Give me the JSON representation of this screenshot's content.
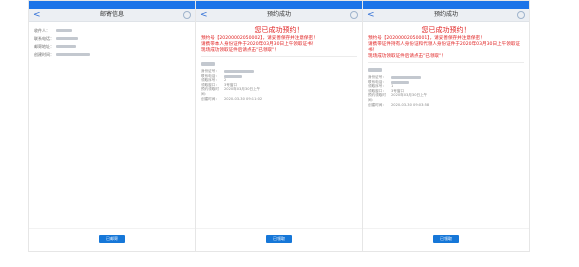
{
  "screens": [
    {
      "nav_back": "<",
      "title": "邮寄信息",
      "fields": [
        {
          "label": "收件人："
        },
        {
          "label": "联系电话："
        },
        {
          "label": "邮寄地址："
        },
        {
          "label": "创建时间："
        }
      ],
      "button_label": "已邮寄"
    },
    {
      "nav_back": "<",
      "title": "预约成功",
      "success_title": "您已成功预约！",
      "booking_line": "预约号【20200002050002】，请妥善保存并注意保密！",
      "notice_line": "请携带本人身份证件于2020年03月30日上午领取证书！",
      "scan_line": "现场成功领取证件后请点击\"已领取\"！",
      "details": [
        {
          "label": "身份证号："
        },
        {
          "label": "联系电话："
        },
        {
          "label": "领取序号：",
          "value": "2"
        },
        {
          "label": "领取窗口：",
          "value": "3号窗口"
        },
        {
          "label": "预约领取时间：",
          "value": "2020年03月30日上午"
        },
        {
          "label": "创建时间：",
          "value": "2020-03-30 09:11:02"
        }
      ],
      "button_label": "已领取"
    },
    {
      "nav_back": "<",
      "title": "预约成功",
      "success_title": "您已成功预约！",
      "booking_line": "预约号【20200002050001】，请妥善保存并注意保密！",
      "notice_line": "请携带证件持有人身份证和代领人身份证件于2020年03月30日上午领取证书！",
      "scan_line": "现场成功领取证件后请点击\"已领取\"！",
      "details": [
        {
          "label": "身份证号："
        },
        {
          "label": "联系电话："
        },
        {
          "label": "领取序号：",
          "value": "1"
        },
        {
          "label": "领取窗口：",
          "value": "3号窗口"
        },
        {
          "label": "预约领取时间：",
          "value": "2020年03月30日上午"
        },
        {
          "label": "创建时间：",
          "value": "2020-03-30 09:03:58"
        }
      ],
      "button_label": "已领取"
    }
  ],
  "colors": {
    "accent": "#1677d8",
    "alert": "#e02020"
  }
}
